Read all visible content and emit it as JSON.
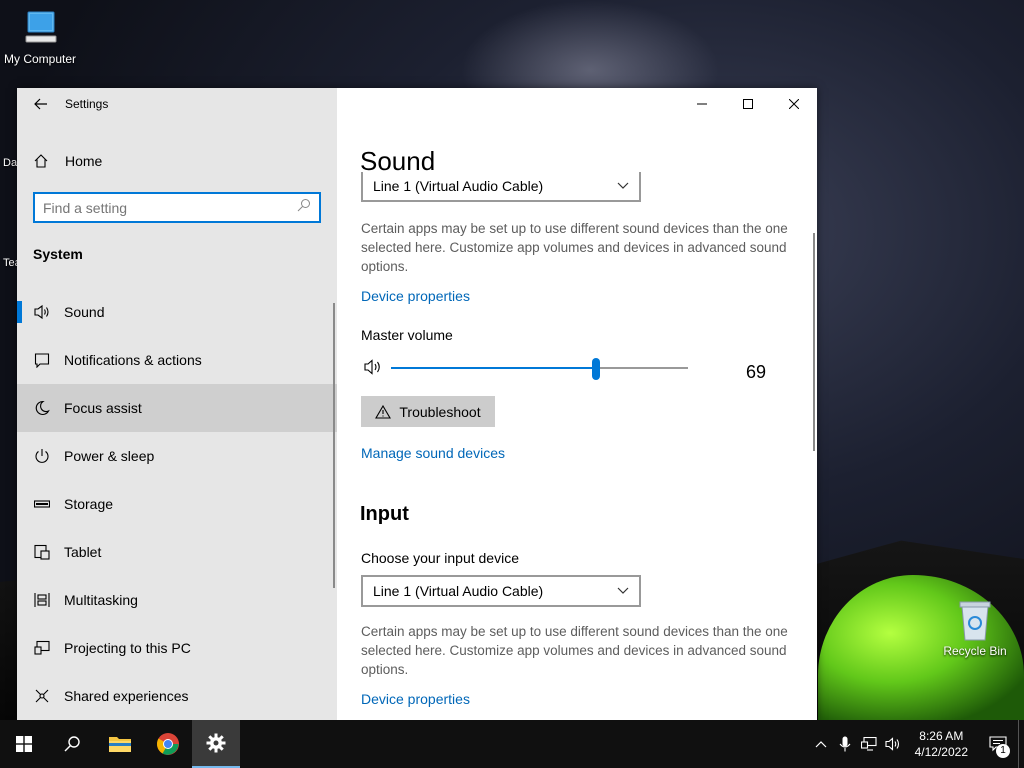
{
  "desktop": {
    "icons": [
      {
        "label": "My Computer"
      },
      {
        "label": "Recycle Bin"
      }
    ],
    "partial_labels": [
      "Da",
      "Tea"
    ]
  },
  "window": {
    "app_title": "Settings",
    "sidebar": {
      "home_label": "Home",
      "search_placeholder": "Find a setting",
      "section_label": "System",
      "items": [
        {
          "label": "Sound",
          "icon": "speaker-icon"
        },
        {
          "label": "Notifications & actions",
          "icon": "message-icon"
        },
        {
          "label": "Focus assist",
          "icon": "moon-icon"
        },
        {
          "label": "Power & sleep",
          "icon": "power-icon"
        },
        {
          "label": "Storage",
          "icon": "storage-icon"
        },
        {
          "label": "Tablet",
          "icon": "tablet-icon"
        },
        {
          "label": "Multitasking",
          "icon": "multitasking-icon"
        },
        {
          "label": "Projecting to this PC",
          "icon": "projecting-icon"
        },
        {
          "label": "Shared experiences",
          "icon": "shared-icon"
        }
      ],
      "selected": "Sound",
      "hovered": "Focus assist"
    },
    "content": {
      "page_title": "Sound",
      "output": {
        "device": "Line 1 (Virtual Audio Cable)",
        "description": "Certain apps may be set up to use different sound devices than the one selected here. Customize app volumes and devices in advanced sound options.",
        "device_properties_link": "Device properties",
        "master_volume_label": "Master volume",
        "volume_value": "69",
        "volume_level_percent": 69,
        "troubleshoot_label": "Troubleshoot",
        "manage_link": "Manage sound devices"
      },
      "input": {
        "title": "Input",
        "choose_label": "Choose your input device",
        "device": "Line 1 (Virtual Audio Cable)",
        "description": "Certain apps may be set up to use different sound devices than the one selected here. Customize app volumes and devices in advanced sound options.",
        "device_properties_link": "Device properties"
      }
    }
  },
  "taskbar": {
    "time": "8:26 AM",
    "date": "4/12/2022",
    "notification_count": "1"
  },
  "colors": {
    "accent": "#0078d7",
    "link": "#0067b8",
    "sidebar_bg": "#e6e6e6",
    "taskbar_bg": "#101010"
  }
}
